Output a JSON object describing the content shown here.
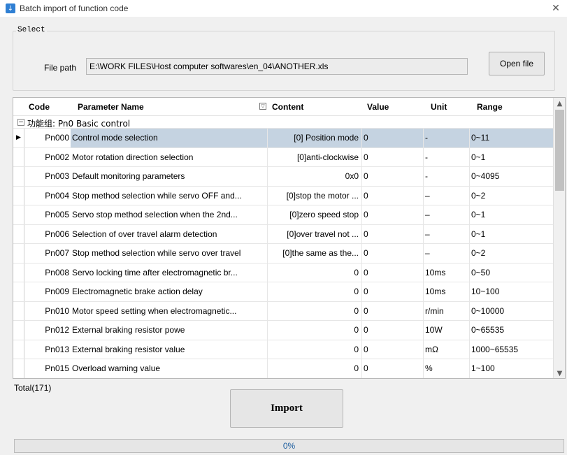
{
  "window": {
    "title": "Batch import of function code",
    "close_glyph": "✕"
  },
  "select_group": {
    "legend": "Select",
    "file_path_label": "File path",
    "file_path_value": "E:\\WORK FILES\\Host computer softwares\\en_04\\ANOTHER.xls",
    "open_file_label": "Open file"
  },
  "table": {
    "headers": {
      "code": "Code",
      "name": "Parameter Name",
      "content": "Content",
      "value": "Value",
      "unit": "Unit",
      "range": "Range"
    },
    "group_label": "功能组: Pn0 Basic control",
    "selected_row_indicator": "▶",
    "rows": [
      {
        "code": "Pn000",
        "name": "Control mode selection",
        "content": "[0] Position mode",
        "value": "0",
        "unit": "-",
        "range": "0~11"
      },
      {
        "code": "Pn002",
        "name": "Motor rotation direction selection",
        "content": "[0]anti-clockwise",
        "value": "0",
        "unit": "-",
        "range": "0~1"
      },
      {
        "code": "Pn003",
        "name": "Default monitoring parameters",
        "content": "0x0",
        "value": "0",
        "unit": "-",
        "range": "0~4095"
      },
      {
        "code": "Pn004",
        "name": "Stop method selection while servo OFF and...",
        "content": "[0]stop the motor ...",
        "value": "0",
        "unit": "–",
        "range": "0~2"
      },
      {
        "code": "Pn005",
        "name": "Servo stop method selection when the 2nd...",
        "content": "[0]zero speed stop",
        "value": "0",
        "unit": "–",
        "range": "0~1"
      },
      {
        "code": "Pn006",
        "name": "Selection of over travel alarm detection",
        "content": "[0]over travel not ...",
        "value": "0",
        "unit": "–",
        "range": "0~1"
      },
      {
        "code": "Pn007",
        "name": "Stop method selection while servo over travel",
        "content": "[0]the same as the...",
        "value": "0",
        "unit": "–",
        "range": "0~2"
      },
      {
        "code": "Pn008",
        "name": "Servo locking time after electromagnetic br...",
        "content": "0",
        "value": "0",
        "unit": "10ms",
        "range": "0~50"
      },
      {
        "code": "Pn009",
        "name": "Electromagnetic brake action delay",
        "content": "0",
        "value": "0",
        "unit": "10ms",
        "range": "10~100"
      },
      {
        "code": "Pn010",
        "name": "Motor speed setting when electromagnetic...",
        "content": "0",
        "value": "0",
        "unit": "r/min",
        "range": "0~10000"
      },
      {
        "code": "Pn012",
        "name": "External braking resistor powe",
        "content": "0",
        "value": "0",
        "unit": "10W",
        "range": "0~65535"
      },
      {
        "code": "Pn013",
        "name": "External braking resistor value",
        "content": "0",
        "value": "0",
        "unit": "mΩ",
        "range": "1000~65535"
      },
      {
        "code": "Pn015",
        "name": "Overload warning value",
        "content": "0",
        "value": "0",
        "unit": "%",
        "range": "1~100"
      }
    ]
  },
  "footer": {
    "total_label": "Total(171)",
    "import_label": "Import",
    "progress_text": "0%",
    "progress_fraction": 0
  },
  "colors": {
    "selected_row": "#c5d3e1",
    "app_icon": "#2f7fd3",
    "progress_text": "#2060a0"
  },
  "icons": {
    "app": "app-logo-icon",
    "filter": "filter-icon",
    "collapse": "collapse-minus-icon",
    "scroll_up": "chevron-up-icon",
    "scroll_down": "chevron-down-icon"
  }
}
